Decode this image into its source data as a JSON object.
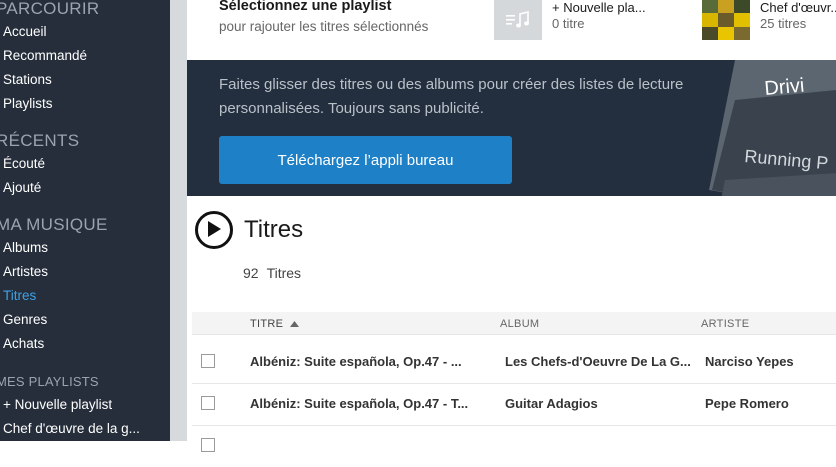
{
  "sidebar": {
    "sections": [
      {
        "heading": "PARCOURIR",
        "items": [
          {
            "label": "Accueil"
          },
          {
            "label": "Recommandé"
          },
          {
            "label": "Stations"
          },
          {
            "label": "Playlists"
          }
        ]
      },
      {
        "heading": "RÉCENTS",
        "items": [
          {
            "label": "Écouté"
          },
          {
            "label": "Ajouté"
          }
        ]
      },
      {
        "heading": "MA MUSIQUE",
        "items": [
          {
            "label": "Albums"
          },
          {
            "label": "Artistes"
          },
          {
            "label": "Titres",
            "active": true
          },
          {
            "label": "Genres"
          },
          {
            "label": "Achats"
          }
        ]
      },
      {
        "heading": "MES PLAYLISTS",
        "items": [
          {
            "label": "+ Nouvelle playlist"
          },
          {
            "label": "Chef d'œuvre de la g..."
          }
        ]
      }
    ]
  },
  "playlist_selector": {
    "title": "Sélectionnez une playlist",
    "subtitle": "pour rajouter les titres sélectionnés",
    "playlists": [
      {
        "name": "+ Nouvelle pla...",
        "count": "0 titre",
        "icon": "music-note-add-icon"
      },
      {
        "name": "Chef d'œuvr...",
        "count": "25 titres",
        "icon": "album-cover"
      }
    ]
  },
  "banner": {
    "text": "Faites glisser des titres ou des albums pour créer des listes de lecture personnalisées. Toujours sans publicité.",
    "button_label": "Téléchargez l’appli bureau",
    "art_lines": [
      "Drivi",
      "Running P"
    ]
  },
  "main": {
    "title": "Titres",
    "count_number": "92",
    "count_label": "Titres",
    "columns": {
      "title": "TITRE",
      "album": "ALBUM",
      "artist": "ARTISTE"
    },
    "tracks": [
      {
        "title": "Albéniz: Suite española, Op.47 - ...",
        "album": "Les Chefs-d'Oeuvre De La G...",
        "artist": "Narciso Yepes"
      },
      {
        "title": "Albéniz: Suite española, Op.47 - T...",
        "album": "Guitar Adagios",
        "artist": "Pepe Romero"
      }
    ]
  },
  "colors": {
    "sidebar_bg": "#252e3a",
    "accent": "#3fa2e6",
    "banner_bg": "#232f3e",
    "button_bg": "#1e80c6"
  }
}
